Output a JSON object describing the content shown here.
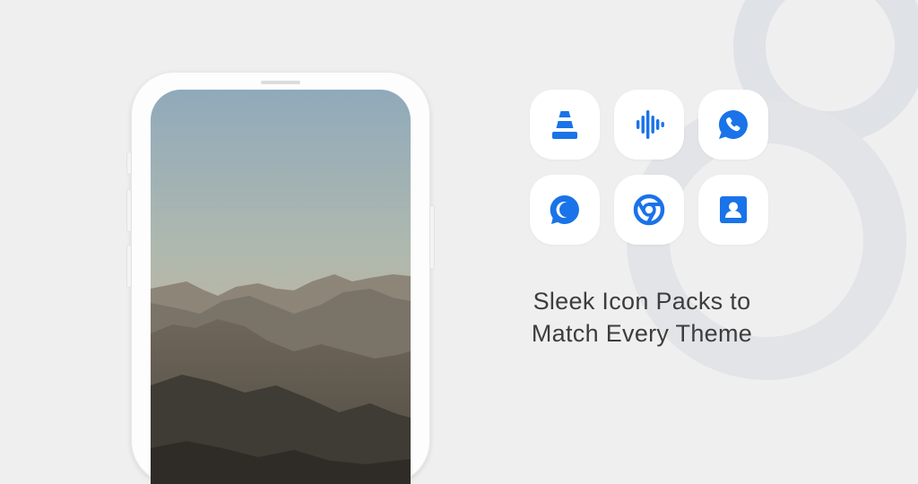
{
  "tagline": {
    "line1": "Sleek Icon Packs to",
    "line2": "Match Every Theme"
  },
  "icons": [
    {
      "name": "vlc-cone-icon"
    },
    {
      "name": "sound-wave-icon"
    },
    {
      "name": "whatsapp-icon"
    },
    {
      "name": "chat-bubble-icon"
    },
    {
      "name": "chrome-icon"
    },
    {
      "name": "contacts-icon"
    }
  ],
  "colors": {
    "background": "#efefef",
    "icon_accent": "#1a73e8",
    "decor_ring": "#dcdfe3",
    "text": "#3d3d3d"
  }
}
